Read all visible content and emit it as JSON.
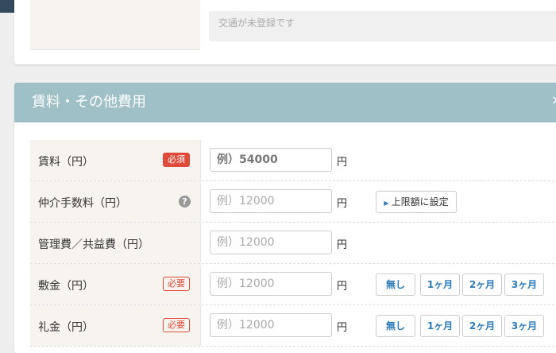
{
  "previous_section": {
    "notice": "交通が未登録です"
  },
  "section": {
    "title": "賃料・その他費用",
    "collapse_icon": "collapse-icon"
  },
  "rows": [
    {
      "label": "賃料（円）",
      "badge": "必須",
      "placeholder": "例）54000",
      "unit": "円"
    },
    {
      "label": "仲介手数料（円）",
      "help_icon": "question-circle-icon",
      "placeholder": "例）12000",
      "unit": "円",
      "limit_button": "上限額に設定"
    },
    {
      "label": "管理費／共益費（円）",
      "placeholder": "例）12000",
      "unit": "円"
    },
    {
      "label": "敷金（円）",
      "badge": "必要",
      "placeholder": "例）12000",
      "unit": "円",
      "options": [
        "無し",
        "1ヶ月",
        "2ヶ月",
        "3ヶ月"
      ]
    },
    {
      "label": "礼金（円）",
      "badge": "必要",
      "placeholder": "例）12000",
      "unit": "円",
      "options": [
        "無し",
        "1ヶ月",
        "2ヶ月",
        "3ヶ月"
      ]
    }
  ],
  "colors": {
    "header": "#9ec0c6",
    "required": "#e04a3b",
    "nav": "#34495e",
    "nav_active": "#e8542e"
  }
}
